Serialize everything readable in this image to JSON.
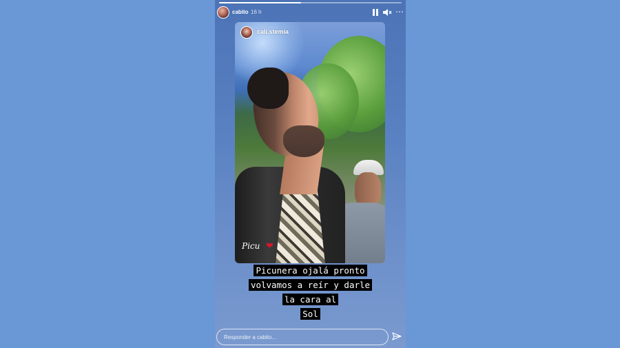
{
  "story": {
    "progress_fraction": 0.45,
    "header": {
      "username": "cabito",
      "time": "16 h",
      "icons": {
        "pause": "pause-icon",
        "mute": "mute-icon",
        "more": "more-icon"
      }
    },
    "photo": {
      "overlay_username": "cali.stemia",
      "handwritten_label": "Picu",
      "heart": "❤"
    },
    "caption_lines": [
      "Picunera ojalá pronto",
      "volvamos a reír y darle",
      "la cara al",
      "Sol"
    ],
    "reply": {
      "placeholder": "Responder a cabito...",
      "value": ""
    },
    "send_icon": "send-icon"
  },
  "colors": {
    "page_background": "#6a98d6",
    "caption_background": "#000000",
    "heart": "#d0192a"
  }
}
